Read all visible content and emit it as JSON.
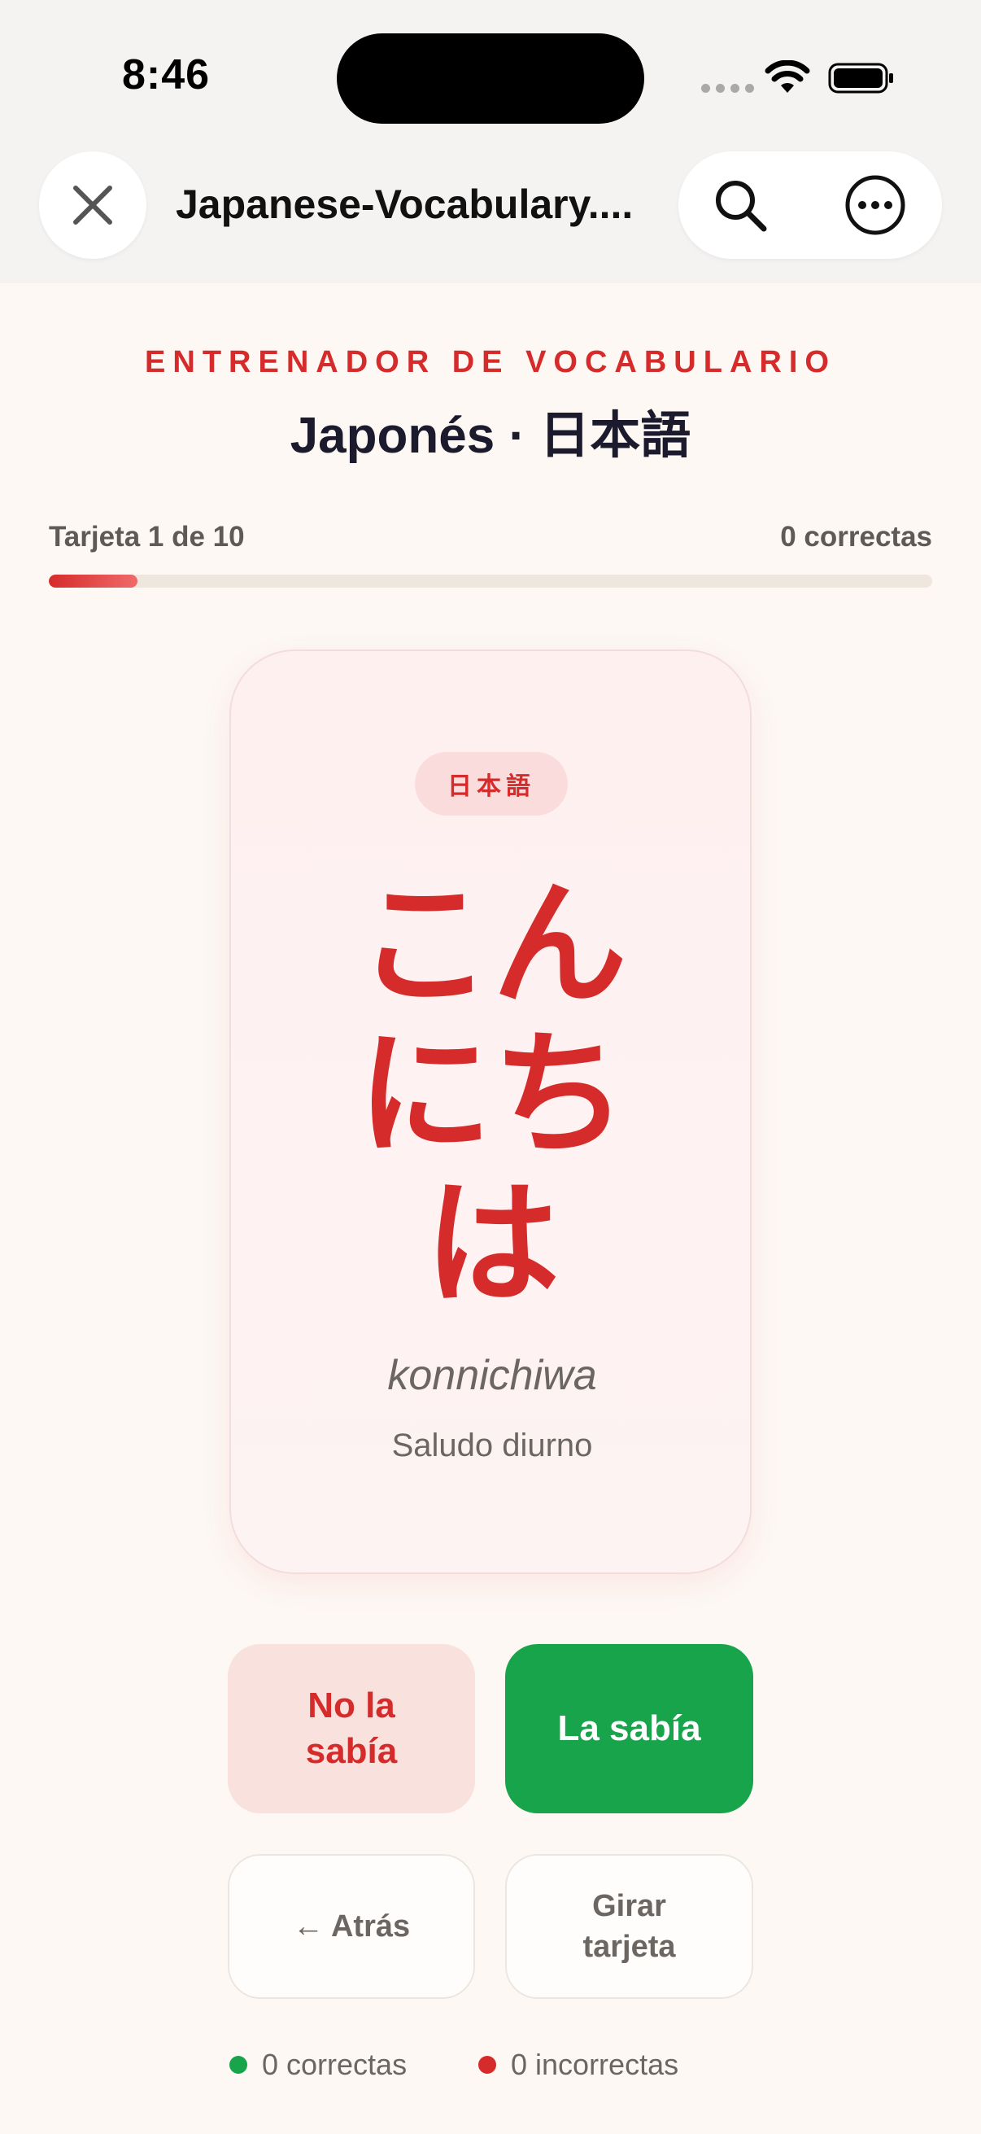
{
  "status_bar": {
    "time": "8:46"
  },
  "browser": {
    "page_title": "Japanese-Vocabulary....",
    "icons": [
      "close-icon",
      "search-icon",
      "more-icon"
    ]
  },
  "header": {
    "eyebrow": "ENTRENADOR DE VOCABULARIO",
    "title": "Japonés · 日本語"
  },
  "progress": {
    "label": "Tarjeta 1 de 10",
    "correct_label": "0 correctas",
    "fraction": 0.1
  },
  "card": {
    "language_badge": "日本語",
    "word_lines": [
      "こん",
      "にち",
      "は"
    ],
    "romaji": "konnichiwa",
    "meaning": "Saludo diurno"
  },
  "actions": {
    "dont_know": "No la sabía",
    "know": "La sabía",
    "back": "← Atrás",
    "flip": "Girar tarjeta"
  },
  "score": {
    "correct": "0 correctas",
    "incorrect": "0 incorrectas"
  },
  "colors": {
    "accent": "#d62b2b",
    "success": "#17a44a",
    "background": "#fdf8f4"
  }
}
